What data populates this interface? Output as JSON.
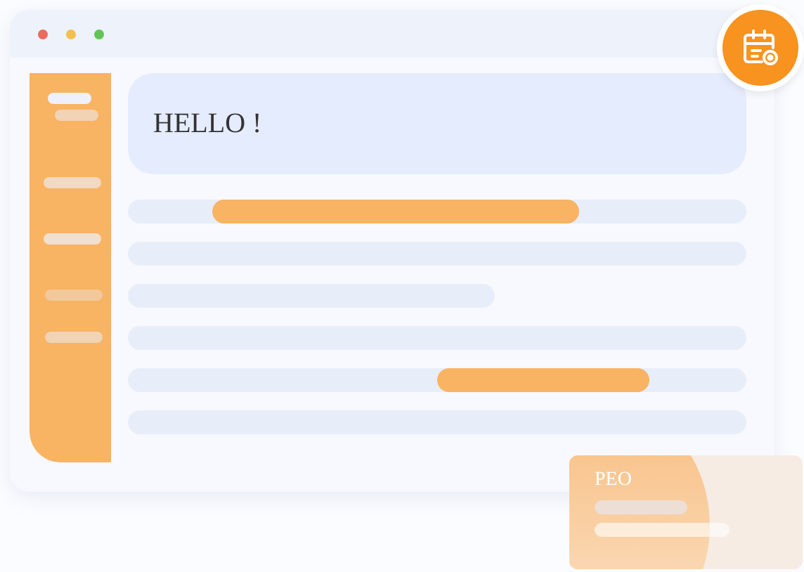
{
  "greeting": {
    "text": "HELLO !"
  },
  "profile_card": {
    "text": "PEO"
  }
}
